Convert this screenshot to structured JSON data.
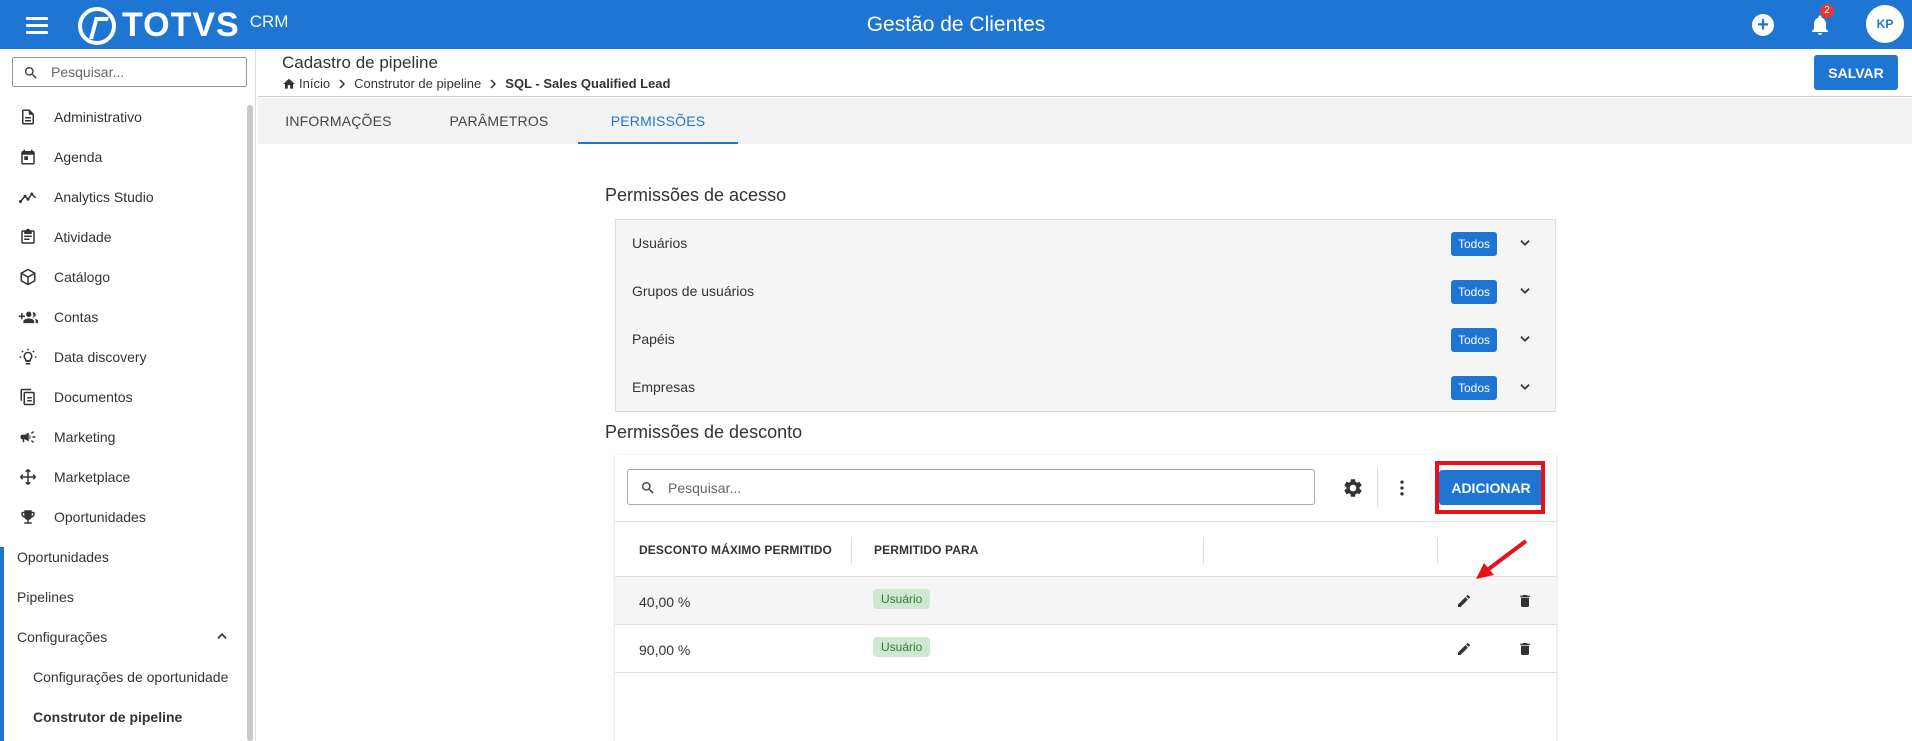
{
  "topbar": {
    "brand": "TOTVS",
    "brand_sub": "CRM",
    "app_title": "Gestão de Clientes",
    "notification_count": "2",
    "user_initials": "KP"
  },
  "sidebar": {
    "search_placeholder": "Pesquisar...",
    "items": [
      {
        "label": "Administrativo",
        "icon": "document-icon"
      },
      {
        "label": "Agenda",
        "icon": "calendar-icon"
      },
      {
        "label": "Analytics Studio",
        "icon": "analytics-icon"
      },
      {
        "label": "Atividade",
        "icon": "clipboard-icon"
      },
      {
        "label": "Catálogo",
        "icon": "cube-icon"
      },
      {
        "label": "Contas",
        "icon": "add-users-icon"
      },
      {
        "label": "Data discovery",
        "icon": "lightbulb-icon"
      },
      {
        "label": "Documentos",
        "icon": "documents-icon"
      },
      {
        "label": "Marketing",
        "icon": "megaphone-icon"
      },
      {
        "label": "Marketplace",
        "icon": "hub-icon"
      },
      {
        "label": "Oportunidades",
        "icon": "trophy-icon"
      }
    ],
    "sub_items": [
      "Oportunidades",
      "Pipelines",
      "Configurações"
    ],
    "config_children": [
      "Configurações de oportunidade",
      "Construtor de pipeline"
    ]
  },
  "header": {
    "title": "Cadastro de pipeline",
    "breadcrumb": [
      "Início",
      "Construtor de pipeline",
      "SQL - Sales Qualified Lead"
    ],
    "save_label": "SALVAR"
  },
  "tabs": [
    "INFORMAÇÕES",
    "PARÂMETROS",
    "PERMISSÕES"
  ],
  "access": {
    "title": "Permissões de acesso",
    "rows": [
      {
        "label": "Usuários",
        "badge": "Todos"
      },
      {
        "label": "Grupos de usuários",
        "badge": "Todos"
      },
      {
        "label": "Papéis",
        "badge": "Todos"
      },
      {
        "label": "Empresas",
        "badge": "Todos"
      }
    ]
  },
  "discount": {
    "title": "Permissões de desconto",
    "search_placeholder": "Pesquisar...",
    "add_label": "ADICIONAR",
    "columns": [
      "DESCONTO MÁXIMO PERMITIDO",
      "PERMITIDO PARA"
    ],
    "rows": [
      {
        "value": "40,00 %",
        "permitted": "Usuário"
      },
      {
        "value": "90,00 %",
        "permitted": "Usuário"
      }
    ]
  },
  "colors": {
    "primary": "#1f76d2",
    "highlight": "#e8111a",
    "chip_bg": "#cfe8d1",
    "chip_text": "#2e7d32"
  }
}
